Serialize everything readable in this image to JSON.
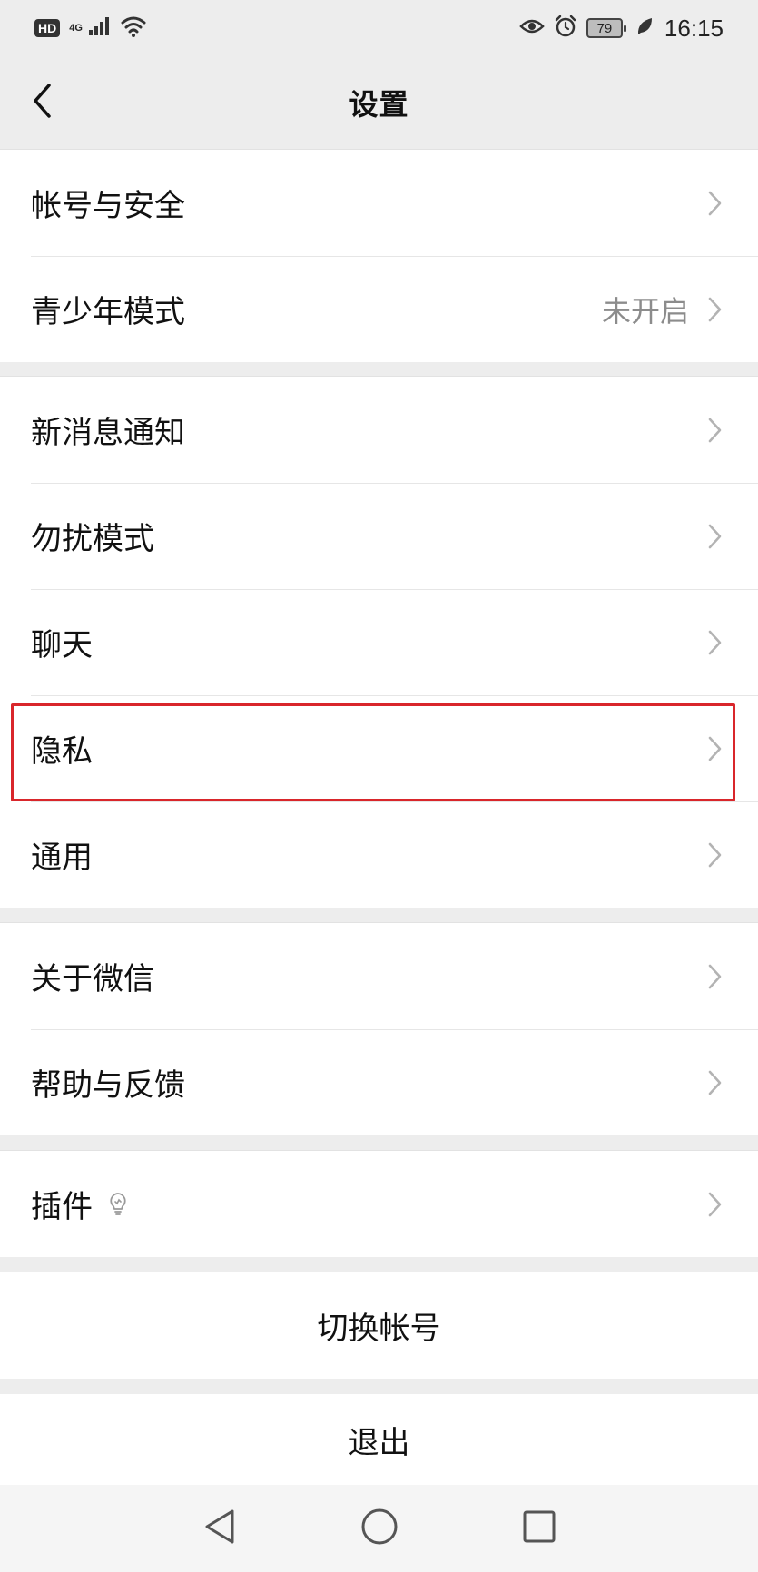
{
  "status_bar": {
    "hd": "HD",
    "network": "4G",
    "battery": "79",
    "time": "16:15"
  },
  "nav": {
    "title": "设置"
  },
  "groups": [
    {
      "items": [
        {
          "label": "帐号与安全",
          "value": ""
        },
        {
          "label": "青少年模式",
          "value": "未开启"
        }
      ]
    },
    {
      "items": [
        {
          "label": "新消息通知",
          "value": ""
        },
        {
          "label": "勿扰模式",
          "value": ""
        },
        {
          "label": "聊天",
          "value": ""
        },
        {
          "label": "隐私",
          "value": ""
        },
        {
          "label": "通用",
          "value": ""
        }
      ]
    },
    {
      "items": [
        {
          "label": "关于微信",
          "value": ""
        },
        {
          "label": "帮助与反馈",
          "value": ""
        }
      ]
    },
    {
      "items": [
        {
          "label": "插件",
          "value": ""
        }
      ]
    }
  ],
  "actions": {
    "switch_account": "切换帐号",
    "logout": "退出"
  },
  "colors": {
    "background": "#ededed",
    "highlight": "#d9262b",
    "secondary_text": "#8c8c8c"
  },
  "icons": {
    "back": "back-arrow-icon",
    "chevron": "chevron-right-icon",
    "plugin": "lightbulb-icon",
    "sys_back": "triangle-back-icon",
    "sys_home": "circle-home-icon",
    "sys_recent": "square-recent-icon"
  }
}
